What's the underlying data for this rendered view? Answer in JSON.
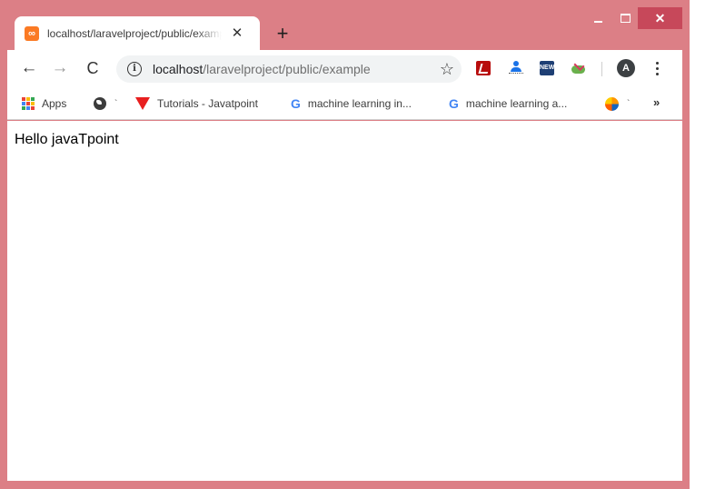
{
  "colors": {
    "frame": "#dc7f86",
    "close_button": "#c7485a",
    "omnibox_bg": "#f1f3f4",
    "xampp_orange": "#fb7a24"
  },
  "tab": {
    "title": "localhost/laravelproject/public/example",
    "close_glyph": "✕",
    "favicon": "xampp-icon"
  },
  "new_tab_glyph": "+",
  "window_controls": {
    "close_glyph": "✕"
  },
  "toolbar": {
    "back_glyph": "←",
    "forward_glyph": "→",
    "reload_glyph": "C",
    "info_glyph": "i",
    "star_glyph": "☆",
    "extensions": [
      "acrobat-icon",
      "person-icon",
      "new-badge-icon",
      "cloud-upload-icon"
    ],
    "new_badge_text": "NEW",
    "avatar_letter": "A"
  },
  "omnibox": {
    "host": "localhost",
    "path": "/laravelproject/public/example"
  },
  "bookmarks": {
    "apps_label": "Apps",
    "tick_mark": "`",
    "items": [
      {
        "label": "Tutorials - Javatpoint",
        "icon": "javatpoint-icon"
      },
      {
        "label": "machine learning in...",
        "icon": "google-icon"
      },
      {
        "label": "machine learning a...",
        "icon": "google-icon"
      }
    ],
    "google_letter": "G",
    "more_glyph": "»"
  },
  "page": {
    "text": "Hello javaTpoint"
  }
}
